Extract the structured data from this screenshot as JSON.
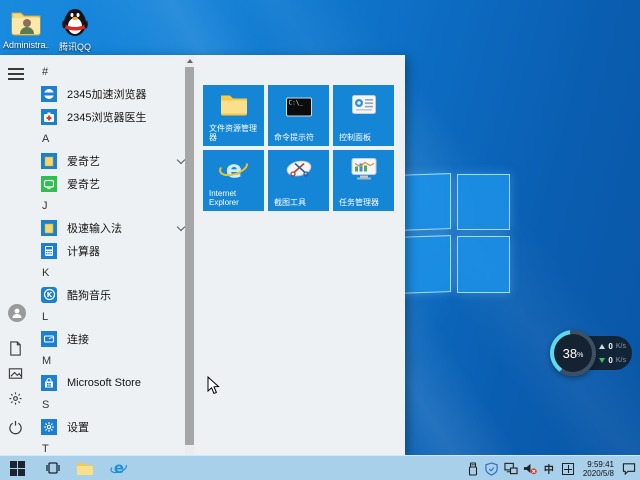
{
  "desktop": {
    "icons": [
      {
        "label": "Administra..."
      },
      {
        "label": "腾讯QQ"
      }
    ]
  },
  "start_menu": {
    "app_list": [
      {
        "type": "section",
        "label": "#"
      },
      {
        "type": "app",
        "label": "2345加速浏览器"
      },
      {
        "type": "app",
        "label": "2345浏览器医生"
      },
      {
        "type": "section",
        "label": "A"
      },
      {
        "type": "folder",
        "label": "爱奇艺"
      },
      {
        "type": "app",
        "label": "爱奇艺"
      },
      {
        "type": "section",
        "label": "J"
      },
      {
        "type": "folder",
        "label": "极速输入法"
      },
      {
        "type": "app",
        "label": "计算器"
      },
      {
        "type": "section",
        "label": "K"
      },
      {
        "type": "app",
        "label": "酷狗音乐"
      },
      {
        "type": "section",
        "label": "L"
      },
      {
        "type": "app",
        "label": "连接"
      },
      {
        "type": "section",
        "label": "M"
      },
      {
        "type": "app",
        "label": "Microsoft Store"
      },
      {
        "type": "section",
        "label": "S"
      },
      {
        "type": "app",
        "label": "设置"
      },
      {
        "type": "section",
        "label": "T"
      }
    ],
    "tiles": [
      {
        "label": "文件资源管理器"
      },
      {
        "label": "命令提示符"
      },
      {
        "label": "控制面板"
      },
      {
        "label": "Internet Explorer"
      },
      {
        "label": "截图工具"
      },
      {
        "label": "任务管理器"
      }
    ]
  },
  "net_widget": {
    "percent": "38",
    "percent_unit": "%",
    "up_value": "0",
    "up_unit": "K/s",
    "down_value": "0",
    "down_unit": "K/s"
  },
  "taskbar": {
    "ime_text": "中",
    "clock": {
      "time": "9:59:41",
      "date": "2020/5/8"
    }
  },
  "colors": {
    "accent_tile": "#1585d5",
    "taskbar": "#a9d0ea",
    "desktop": "#0d6ec4",
    "widget_ring": "#5fd8e8"
  }
}
